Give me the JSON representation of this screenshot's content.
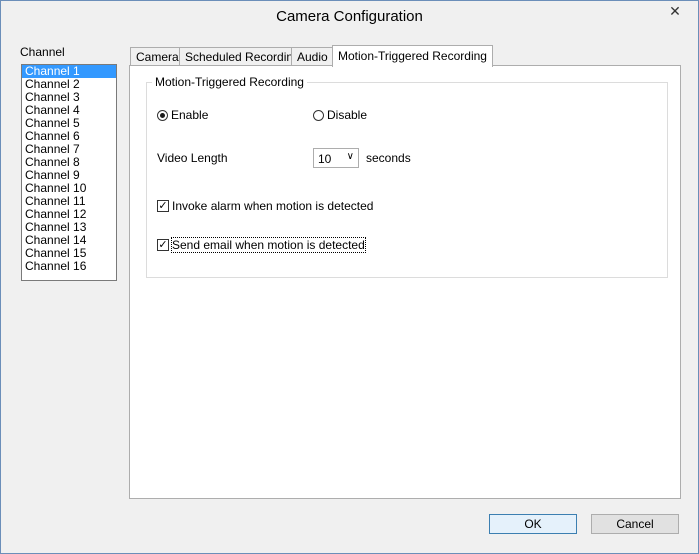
{
  "window": {
    "title": "Camera Configuration",
    "close_glyph": "✕"
  },
  "channels": {
    "label": "Channel",
    "items": [
      "Channel 1",
      "Channel 2",
      "Channel 3",
      "Channel 4",
      "Channel 5",
      "Channel 6",
      "Channel 7",
      "Channel 8",
      "Channel 9",
      "Channel 10",
      "Channel 11",
      "Channel 12",
      "Channel 13",
      "Channel 14",
      "Channel 15",
      "Channel 16"
    ],
    "selected": "Channel 1"
  },
  "tabs": [
    "Camera",
    "Scheduled Recording",
    "Audio",
    "Motion-Triggered Recording"
  ],
  "active_tab": "Motion-Triggered Recording",
  "motion": {
    "group_title": "Motion-Triggered Recording",
    "enable_label": "Enable",
    "disable_label": "Disable",
    "enabled": true,
    "video_length_label": "Video Length",
    "video_length_value": "10",
    "seconds_label": "seconds",
    "invoke_alarm_label": "Invoke alarm when motion is detected",
    "invoke_alarm_checked": true,
    "send_email_label": "Send email when motion is detected",
    "send_email_checked": true
  },
  "buttons": {
    "ok": "OK",
    "cancel": "Cancel"
  },
  "icons": {
    "close": "close-icon",
    "dropdown": "chevron-down-icon",
    "check": "checkmark-icon"
  }
}
